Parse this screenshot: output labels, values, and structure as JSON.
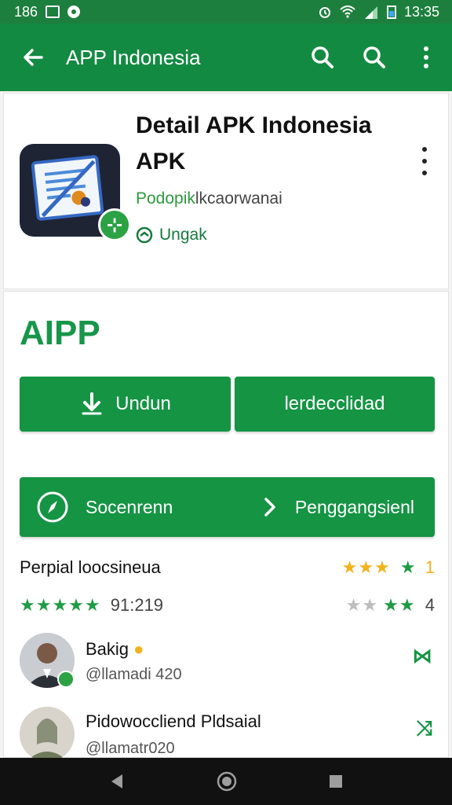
{
  "status_bar": {
    "time_left": "186",
    "time_right": "13:35"
  },
  "appbar": {
    "title": "APP Indonesia",
    "icons": [
      "back-arrow-icon",
      "search-icon",
      "search-icon",
      "more-vert-icon"
    ]
  },
  "header_card": {
    "title_line1": "Detail APK Indonesia",
    "title_line2": "APK",
    "developer_highlight": "Podopik",
    "developer_rest": "lkcaorwanai",
    "unggah_label": "Ungak"
  },
  "detail_card": {
    "app_name": "AIPP",
    "download_label": "Undun",
    "secondary_label": "lerdecclidad",
    "secure_label": "Socenrenn",
    "manage_label": "Penggangsienl",
    "rating_row": {
      "label": "Perpial loocsineua",
      "stars": "★★★",
      "extra_star": "★",
      "count": "1"
    },
    "reviews_row": {
      "stars": "★★★★★",
      "count_label": "91:219",
      "right_count": "4"
    },
    "users": [
      {
        "name": "Bakig",
        "handle": "@llamadi 420"
      },
      {
        "name": "Pidowoccliend Pldsaial",
        "handle": "@llamatr020"
      }
    ]
  },
  "colors": {
    "primary": "#138a42",
    "accent_green": "#159444",
    "star_gold": "#f2b21b",
    "star_green": "#1f9b44"
  }
}
